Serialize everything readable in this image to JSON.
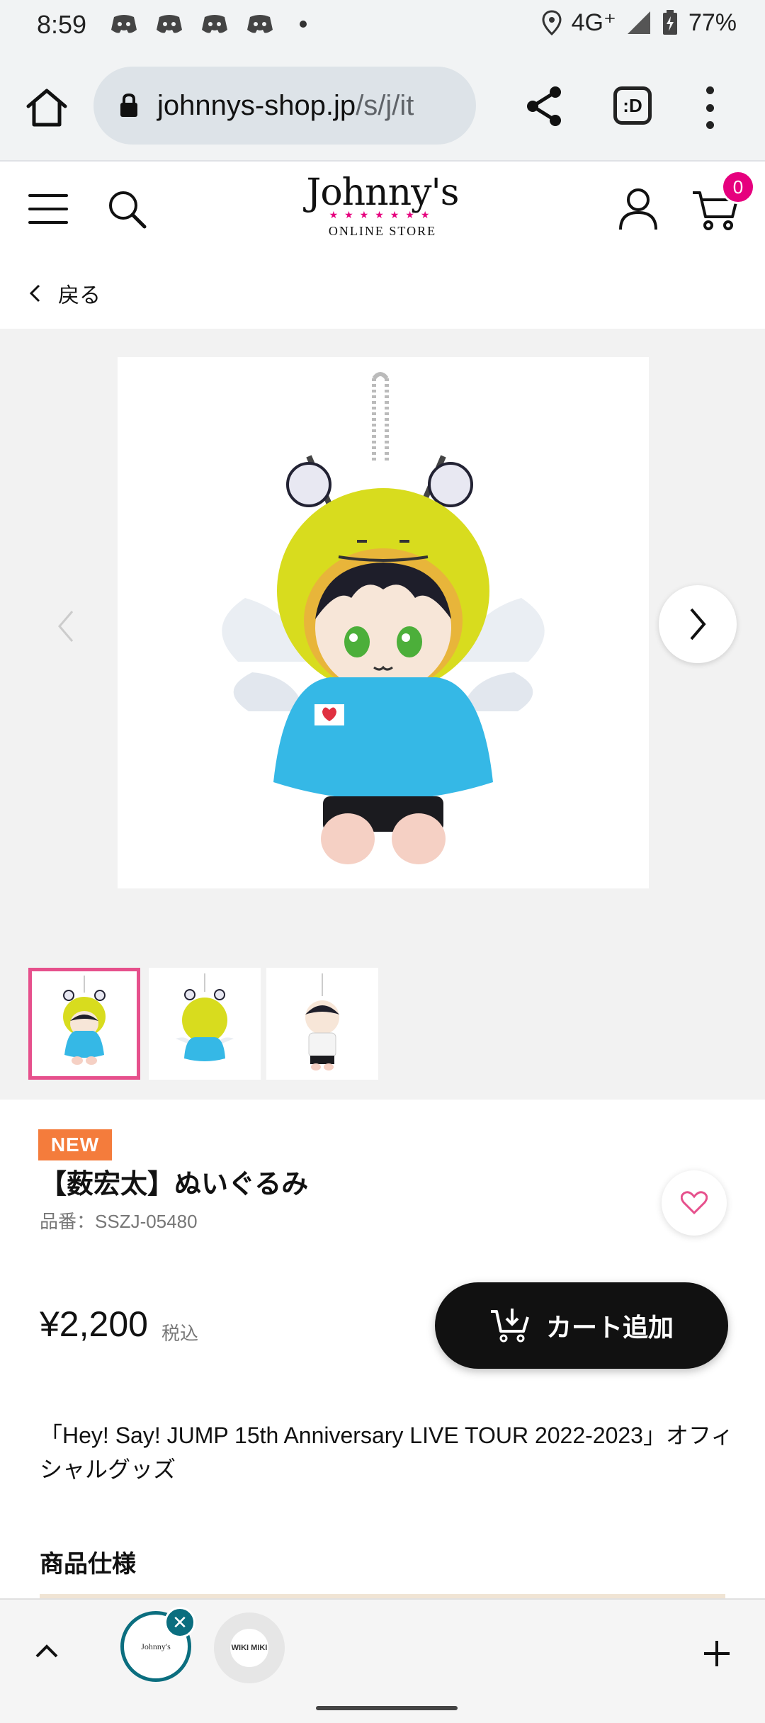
{
  "status_bar": {
    "time": "8:59",
    "network": "4G⁺",
    "battery": "77%",
    "notification_icons": [
      "discord-icon",
      "discord-icon",
      "discord-icon",
      "discord-icon",
      "more-dot-icon"
    ]
  },
  "browser": {
    "url_domain": "johnnys-shop.jp",
    "url_path": "/s/j/it",
    "tabs_button_label": ":D"
  },
  "header": {
    "logo_main": "Johnny's",
    "logo_stars": "★★★★★★★",
    "logo_sub": "ONLINE STORE",
    "cart_count": "0"
  },
  "back_link": {
    "label": "戻る"
  },
  "product": {
    "badge": "NEW",
    "title": "【薮宏太】ぬいぐるみ",
    "code": "品番：SSZJ-05480",
    "price": "¥2,200",
    "tax_label": "税込",
    "add_to_cart_label": "カート追加",
    "description": "「Hey! Say! JUMP 15th Anniversary LIVE TOUR 2022-2023」オフィシャルグッズ",
    "spec_heading": "商品仕様"
  },
  "bottom_bar": {
    "tab1_label": "Johnny's",
    "tab2_label": "WIKI MIKI"
  },
  "colors": {
    "accent_pink": "#e6007e",
    "new_badge": "#f47c3c",
    "tab_teal": "#0b6e7f",
    "plush_yellow": "#d8dc1e",
    "plush_blue": "#35b8e6"
  }
}
